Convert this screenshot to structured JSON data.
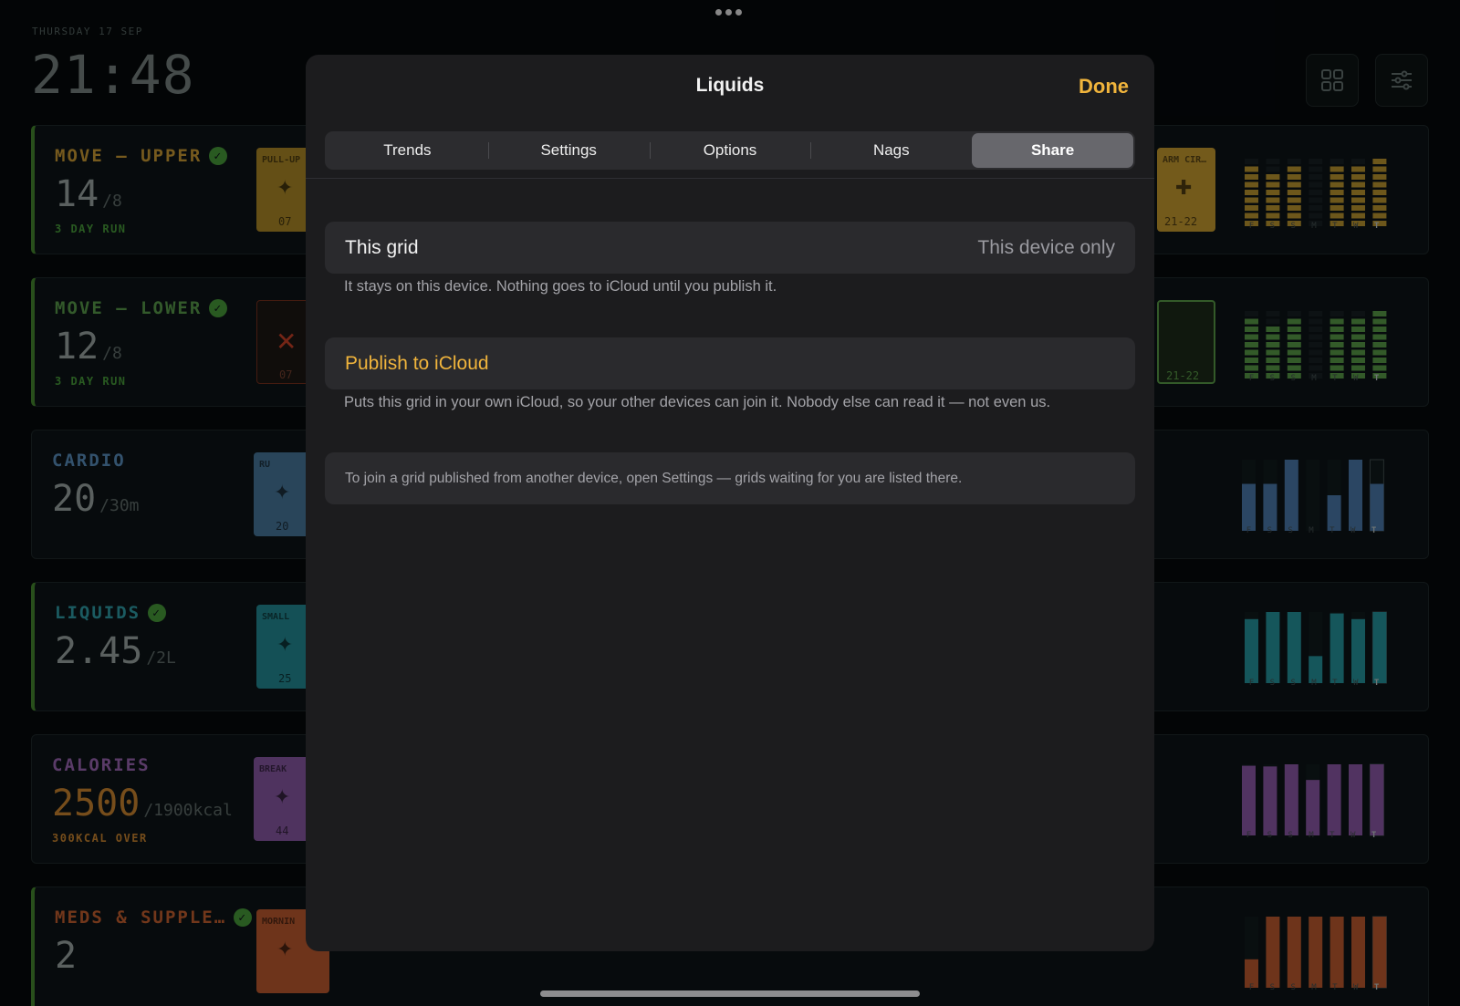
{
  "dashboard": {
    "date": "THURSDAY 17 SEP",
    "time": "21:48",
    "days": [
      "F",
      "S",
      "S",
      "M",
      "T",
      "W",
      "T"
    ],
    "cards": [
      {
        "title": "MOVE — UPPER",
        "done": true,
        "color": "#b58a2e",
        "value": "14",
        "target": "/8",
        "sub": "3 DAY RUN",
        "sub_color": "#3f8a34",
        "tile_label": "PULL-UP",
        "tile_num": "07",
        "tile_color": "#9a7a22",
        "right_label": "ARM CIR…",
        "right_num": "21-22",
        "right_color": "#b18a2a",
        "bar_color": "#a8862a",
        "bar_levels": [
          0.8,
          0.7,
          0.8,
          0,
          0.8,
          0.8,
          0.9
        ]
      },
      {
        "title": "MOVE — LOWER",
        "done": true,
        "color": "#4f8a42",
        "value": "12",
        "target": "/8",
        "sub": "3 DAY RUN",
        "sub_color": "#3f8a34",
        "tile_label": "",
        "tile_num": "07",
        "tile_color": "#1a1412",
        "right_label": "",
        "right_num": "21-22",
        "right_color": "#1a2616",
        "bar_color": "#4f8a3f",
        "bar_levels": [
          0.8,
          0.7,
          0.8,
          0,
          0.8,
          0.8,
          0.9
        ]
      },
      {
        "title": "CARDIO",
        "done": false,
        "color": "#4f7ea8",
        "value": "20",
        "target": "/30m",
        "sub": "",
        "sub_color": "#4f7ea8",
        "tile_label": "RU",
        "tile_num": "20",
        "tile_color": "#3f6a8a",
        "right_label": "",
        "right_num": "",
        "right_color": "",
        "bar_color": "#426c99",
        "bar_levels": [
          0.66,
          0.66,
          1.0,
          0,
          0.5,
          1.0,
          0.66
        ]
      },
      {
        "title": "LIQUIDS",
        "done": true,
        "color": "#2a8d95",
        "value": "2.45",
        "target": "/2L",
        "sub": "",
        "sub_color": "#2a8d95",
        "tile_label": "SMALL",
        "tile_num": "25",
        "tile_color": "#1f7c84",
        "right_label": "",
        "right_num": "",
        "right_color": "",
        "bar_color": "#21848c",
        "bar_levels": [
          0.9,
          1.0,
          1.0,
          0.38,
          0.98,
          0.9,
          1.0
        ]
      },
      {
        "title": "CALORIES",
        "done": false,
        "color": "#8a5ba0",
        "value": "2500",
        "target": "/1900kcal",
        "sub": "300KCAL OVER",
        "sub_color": "#b5772a",
        "tile_label": "BREAK",
        "tile_num": "44",
        "tile_color": "#7a4f92",
        "right_label": "",
        "right_num": "",
        "right_color": "",
        "bar_color": "#7d4f95",
        "bar_levels": [
          0.98,
          0.97,
          1.0,
          0.78,
          1.0,
          1.0,
          1.0
        ]
      },
      {
        "title": "MEDS & SUPPLE…",
        "done": true,
        "color": "#b0552a",
        "value": "2",
        "target": "",
        "sub": "",
        "sub_color": "#b0552a",
        "tile_label": "MORNIN",
        "tile_num": "",
        "tile_color": "#a9512a",
        "right_label": "",
        "right_num": "",
        "right_color": "",
        "bar_color": "#a9512a",
        "bar_levels": [
          0.4,
          1.0,
          1.0,
          1.0,
          1.0,
          1.0,
          1.0
        ]
      }
    ]
  },
  "modal": {
    "title": "Liquids",
    "done_label": "Done",
    "tabs": [
      {
        "label": "Trends",
        "active": false
      },
      {
        "label": "Settings",
        "active": false
      },
      {
        "label": "Options",
        "active": false
      },
      {
        "label": "Nags",
        "active": false
      },
      {
        "label": "Share",
        "active": true
      }
    ],
    "grid_row": {
      "label": "This grid",
      "value": "This device only"
    },
    "grid_note": "It stays on this device. Nothing goes to iCloud until you publish it.",
    "publish": {
      "label": "Publish to iCloud"
    },
    "publish_note": "Puts this grid in your own iCloud, so your other devices can join it. Nobody else can read it — not even us.",
    "join_note": "To join a grid published from another device, open Settings — grids waiting for you are listed there."
  }
}
